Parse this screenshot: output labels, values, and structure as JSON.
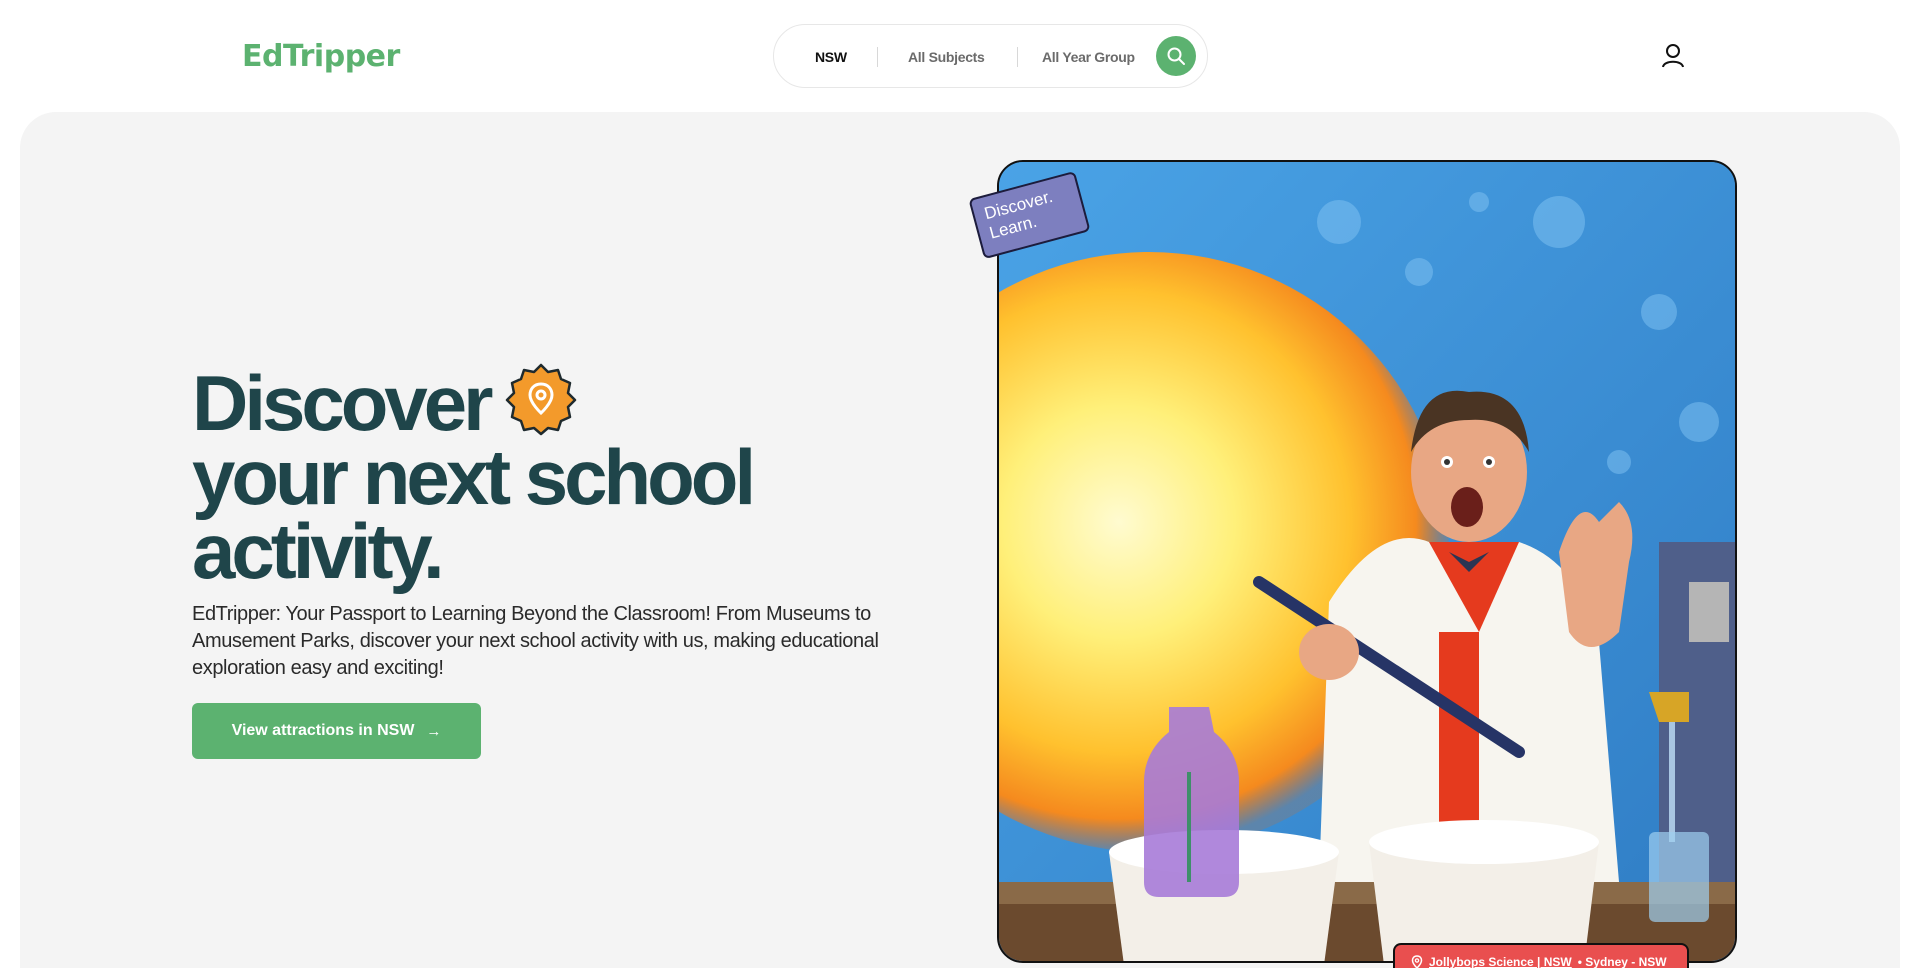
{
  "brand": {
    "name": "EdTripper",
    "color": "#5cb270"
  },
  "search": {
    "state": "NSW",
    "subject": "All Subjects",
    "year_group": "All Year Group"
  },
  "hero": {
    "headline_line1": "Discover",
    "headline_line2": "your next school",
    "headline_line3": "activity.",
    "description": "EdTripper: Your Passport to Learning Beyond the Classroom! From Museums to Amusement Parks, discover your next school activity with us, making educational exploration easy and exciting!",
    "cta_label": "View attractions in NSW",
    "sticker_line1": "Discover.",
    "sticker_line2": "Learn.",
    "caption_link": "Jollybops Science | NSW",
    "caption_location": "• Sydney - NSW"
  },
  "colors": {
    "accent_green": "#5cb270",
    "headline": "#1f454a",
    "badge_orange": "#f39a2b",
    "caption_red": "#e94f4f",
    "sticker_purple": "#7d7fbf"
  },
  "icons": {
    "search": "search-icon",
    "user": "user-icon",
    "location_badge": "location-pin-icon",
    "arrow": "arrow-right-icon"
  }
}
